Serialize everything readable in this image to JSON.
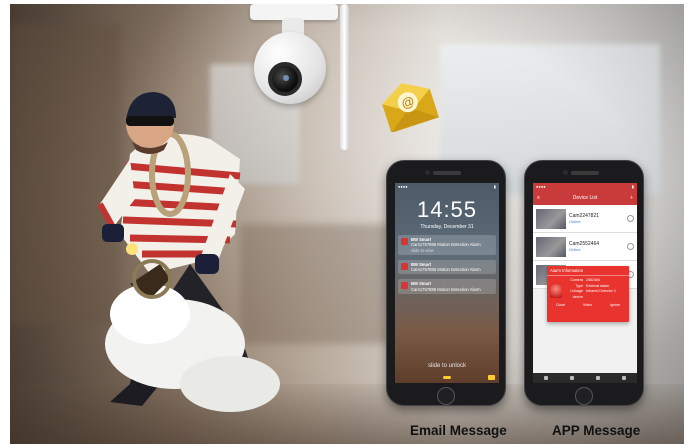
{
  "email_phone": {
    "time": "14:55",
    "date": "Thursday, December 31",
    "notifications": [
      {
        "title": "BW Smart",
        "text": "Cam1757885 Motion Detection Alarm",
        "sub": "slide to view"
      },
      {
        "title": "BW Smart",
        "text": "Cam1757885 Motion Detection Alarm",
        "sub": ""
      },
      {
        "title": "BW Smart",
        "text": "Cam1757885 Motion Detection Alarm",
        "sub": ""
      }
    ],
    "slide_text": "slide to unlock"
  },
  "app_phone": {
    "header_title": "Device List",
    "devices": [
      {
        "name": "Cam2247821",
        "status": "Online"
      },
      {
        "name": "Cam2552464",
        "status": "Online"
      },
      {
        "name": "",
        "status": ""
      }
    ],
    "alarm": {
      "title": "Alarm Information",
      "fields": [
        {
          "key": "Camera",
          "value": "2552464"
        },
        {
          "key": "Type",
          "value": "External alarm"
        },
        {
          "key": "Linkage device",
          "value": "Infrared Detector 1"
        }
      ],
      "buttons": [
        "Close",
        "Video",
        "Ignore"
      ]
    }
  },
  "captions": {
    "email": "Email Message",
    "app": "APP Message"
  },
  "colors": {
    "app_red": "#c93a3a",
    "alarm_red": "#e8332f",
    "email_gold": "#e8b825"
  },
  "icons": [
    "ip-camera-icon",
    "email-at-icon",
    "siren-icon",
    "gear-icon",
    "menu-icon",
    "plus-icon"
  ]
}
